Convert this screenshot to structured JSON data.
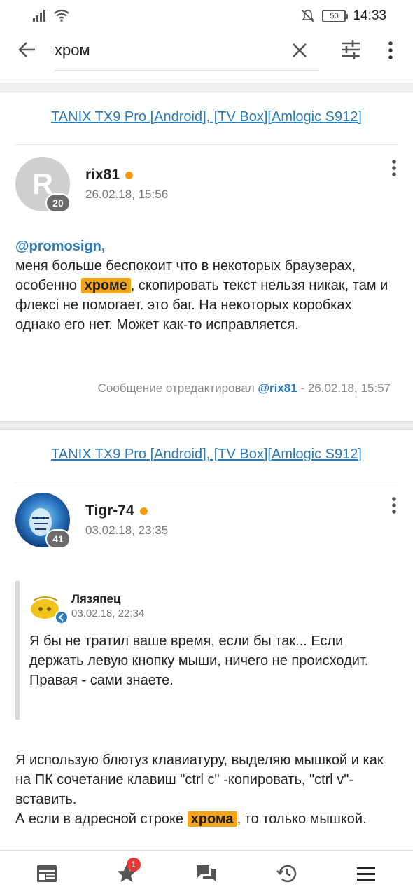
{
  "status_bar": {
    "time": "14:33",
    "battery": "50"
  },
  "search": {
    "query": "хром"
  },
  "posts": [
    {
      "topic": "TANIX TX9 Pro [Android], [TV Box][Amlogic S912]",
      "author": "rix81",
      "avatar_letter": "R",
      "reputation": "20",
      "date": "26.02.18, 15:56",
      "body": {
        "mention": "@promosign,",
        "text_before": "меня больше беспокоит что в некоторых браузерах, особенно ",
        "highlight": "хроме",
        "text_after": ", скопировать текст нельзя никак, там и флексi не помогает. это баг. На некоторых коробках однако его нет. Может как-то исправляется."
      },
      "edit_note": {
        "prefix": "Сообщение отредактировал",
        "editor": "@rix81",
        "suffix": "- 26.02.18, 15:57"
      }
    },
    {
      "topic": "TANIX TX9 Pro [Android], [TV Box][Amlogic S912]",
      "author": "Tigr-74",
      "reputation": "41",
      "date": "03.02.18, 23:35",
      "quote": {
        "author": "Лязяпец",
        "date": "03.02.18, 22:34",
        "line1": "Я бы не тратил ваше время, если бы так... Если держать левую кнопку мыши, ничего не происходит.",
        "line2": "Правая - сами знаете."
      },
      "body": {
        "text_1": "Я использую блютуз клавиатуру, выделяю мышкой и как на ПК сочетание клавиш \"ctrl c\" -копировать, \"ctrl v\"-вставить.",
        "text_2_before": "А если в адресной строке ",
        "highlight": "хрома",
        "text_2_after": ", то только мышкой."
      }
    }
  ],
  "bottom_nav": {
    "items": [
      "news-icon",
      "favorites-icon",
      "messages-icon",
      "history-icon",
      "menu-icon"
    ],
    "favorites_badge": "1"
  }
}
